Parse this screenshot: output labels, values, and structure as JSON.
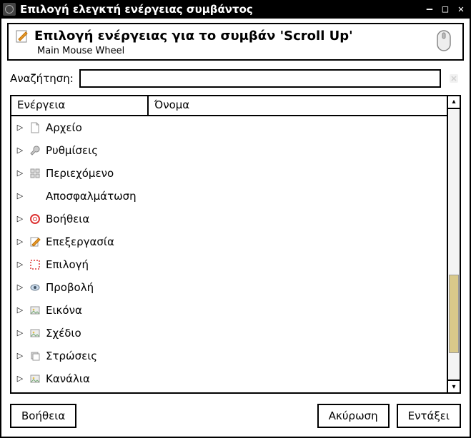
{
  "titlebar": {
    "title": "Επιλογή ελεγκτή ενέργειας συμβάντος"
  },
  "header": {
    "title": "Επιλογή ενέργειας για το συμβάν 'Scroll Up'",
    "subtitle": "Main Mouse Wheel"
  },
  "search": {
    "label": "Αναζήτηση:",
    "value": ""
  },
  "columns": {
    "action": "Ενέργεια",
    "name": "Όνομα"
  },
  "tree": [
    {
      "icon": "file-icon",
      "label": "Αρχείο"
    },
    {
      "icon": "wrench-icon",
      "label": "Ρυθμίσεις"
    },
    {
      "icon": "grid-icon",
      "label": "Περιεχόμενο"
    },
    {
      "icon": "",
      "label": "Αποσφαλμάτωση"
    },
    {
      "icon": "lifebuoy-icon",
      "label": "Βοήθεια"
    },
    {
      "icon": "edit-icon",
      "label": "Επεξεργασία"
    },
    {
      "icon": "select-icon",
      "label": "Επιλογή"
    },
    {
      "icon": "eye-icon",
      "label": "Προβολή"
    },
    {
      "icon": "image-icon",
      "label": "Εικόνα"
    },
    {
      "icon": "image-icon",
      "label": "Σχέδιο"
    },
    {
      "icon": "layers-icon",
      "label": "Στρώσεις"
    },
    {
      "icon": "image-icon",
      "label": "Κανάλια"
    }
  ],
  "buttons": {
    "help": "Βοήθεια",
    "cancel": "Ακύρωση",
    "ok": "Εντάξει"
  }
}
